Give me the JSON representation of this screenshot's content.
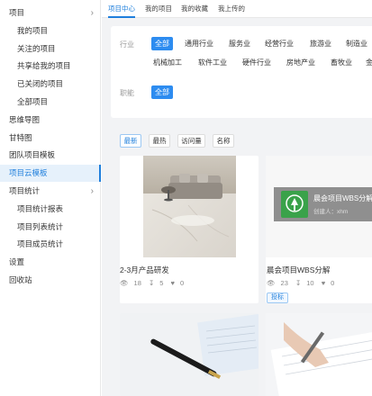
{
  "sidebar": {
    "items": [
      {
        "label": "项目",
        "level": 0,
        "chevron": true
      },
      {
        "label": "我的项目",
        "level": 1
      },
      {
        "label": "关注的项目",
        "level": 1
      },
      {
        "label": "共享给我的项目",
        "level": 1
      },
      {
        "label": "已关闭的项目",
        "level": 1
      },
      {
        "label": "全部项目",
        "level": 1
      },
      {
        "label": "思维导图",
        "level": 0
      },
      {
        "label": "甘特图",
        "level": 0
      },
      {
        "label": "团队项目模板",
        "level": 0
      },
      {
        "label": "项目云模板",
        "level": 0,
        "active": true
      },
      {
        "label": "项目统计",
        "level": 0,
        "chevron": true
      },
      {
        "label": "项目统计报表",
        "level": 1
      },
      {
        "label": "项目列表统计",
        "level": 1
      },
      {
        "label": "项目成员统计",
        "level": 1
      },
      {
        "label": "设置",
        "level": 0
      },
      {
        "label": "回收站",
        "level": 0
      }
    ],
    "chevron_glyph": "›"
  },
  "tabs": [
    "项目中心",
    "我的项目",
    "我的收藏",
    "我上传的"
  ],
  "filters": {
    "industry_label": "行业",
    "industry_tags": [
      "全部",
      "通用行业",
      "服务业",
      "经营行业",
      "旅游业",
      "制造业",
      "机械加工",
      "软件工业",
      "硬件行业",
      "房地产业",
      "畜牧业",
      "金"
    ],
    "function_label": "职能",
    "function_tags": [
      "全部"
    ]
  },
  "sort": [
    "最新",
    "最热",
    "访问量",
    "名称"
  ],
  "cards": [
    {
      "title": "2-3月产品研发",
      "views": "18",
      "downloads": "5",
      "likes": "0"
    },
    {
      "title": "晨会项目WBS分解",
      "views": "23",
      "downloads": "10",
      "likes": "0",
      "badge": "投标"
    },
    {
      "title": "",
      "views": "",
      "downloads": "",
      "likes": ""
    },
    {
      "title": "",
      "views": "",
      "downloads": "",
      "likes": ""
    }
  ],
  "preview": {
    "title": "晨会项目WBS分解",
    "creator": "创建人：xhm"
  },
  "colors": {
    "accent": "#1f7fdc",
    "tag_active": "#2d8cf0",
    "sidebar_active_bg": "#e6f1fb",
    "preview_green": "#3aa24a"
  }
}
